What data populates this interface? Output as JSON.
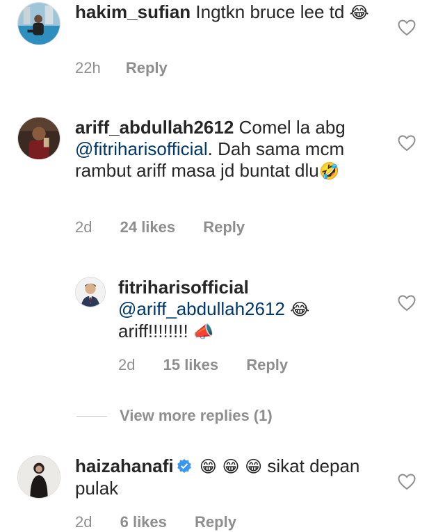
{
  "comments": [
    {
      "username": "hakim_sufian",
      "text": "Ingtkn bruce lee td",
      "emoji": "😂",
      "time": "22h",
      "likes": "",
      "reply": "Reply"
    },
    {
      "username": "ariff_abdullah2612",
      "text_before": "Comel la abg",
      "mention": "@fitriharisofficial",
      "text_after": ". Dah sama mcm rambut ariff masa jd buntat dlu",
      "emoji": "🤣",
      "time": "2d",
      "likes": "24 likes",
      "reply": "Reply"
    },
    {
      "username": "fitriharisofficial",
      "mention": "@ariff_abdullah2612",
      "emoji1": "😂",
      "text": "ariff!!!!!!!!",
      "emoji2": "📣",
      "time": "2d",
      "likes": "15 likes",
      "reply": "Reply"
    },
    {
      "username": "haizahanafi",
      "emojis": "😁 😁 😁",
      "text": "sikat depan pulak",
      "time": "2d",
      "likes": "6 likes",
      "reply": "Reply"
    }
  ],
  "view_more": "View more replies (1)",
  "icons": {
    "like": "heart-outline-icon",
    "verified": "verified-badge-icon"
  },
  "colors": {
    "mention": "#00376b",
    "meta": "#8e8e8e",
    "verified": "#3897f0"
  }
}
